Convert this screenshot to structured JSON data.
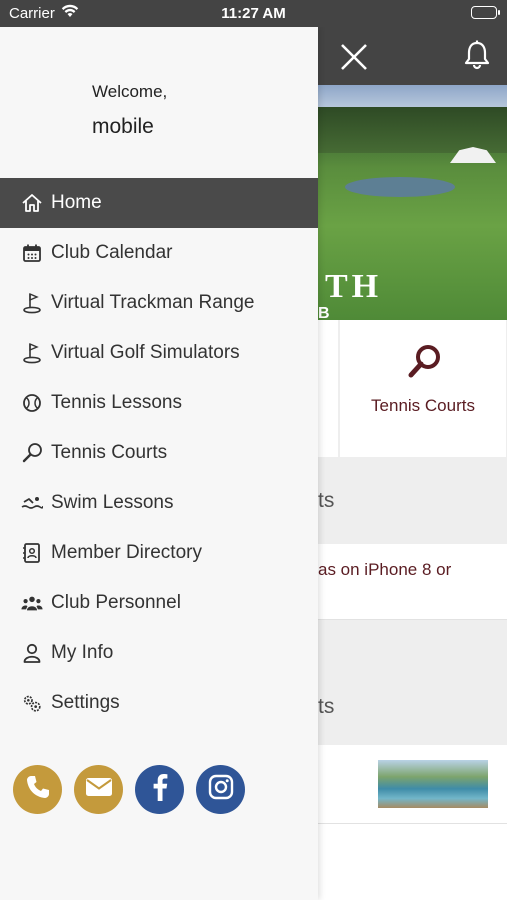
{
  "status_bar": {
    "carrier": "Carrier",
    "time": "11:27 AM"
  },
  "drawer": {
    "welcome": "Welcome,",
    "username": "mobile",
    "menu": [
      {
        "label": "Home",
        "icon": "home-icon",
        "active": true
      },
      {
        "label": "Club Calendar",
        "icon": "calendar-icon"
      },
      {
        "label": "Virtual Trackman Range",
        "icon": "golf-flag-icon"
      },
      {
        "label": "Virtual Golf Simulators",
        "icon": "golf-flag-icon"
      },
      {
        "label": "Tennis Lessons",
        "icon": "tennis-ball-icon"
      },
      {
        "label": "Tennis Courts",
        "icon": "tennis-racket-icon"
      },
      {
        "label": "Swim Lessons",
        "icon": "swimmer-icon"
      },
      {
        "label": "Member Directory",
        "icon": "contact-book-icon"
      },
      {
        "label": "Club Personnel",
        "icon": "people-group-icon"
      },
      {
        "label": "My Info",
        "icon": "user-icon"
      },
      {
        "label": "Settings",
        "icon": "gears-icon"
      }
    ],
    "socials": [
      {
        "name": "phone",
        "icon": "phone-icon",
        "color": "#c49a3c"
      },
      {
        "name": "email",
        "icon": "envelope-icon",
        "color": "#c49a3c"
      },
      {
        "name": "facebook",
        "icon": "facebook-icon",
        "color": "#2f5597"
      },
      {
        "name": "instagram",
        "icon": "instagram-icon",
        "color": "#2f5597"
      }
    ]
  },
  "background": {
    "header_icons": [
      "close-icon",
      "bell-icon"
    ],
    "hero_text": "TH",
    "hero_subtext": "B",
    "tile_label": "Tennis Courts",
    "section1_title": "ts",
    "row1_text": "as on iPhone 8 or",
    "section2_title": "ts"
  },
  "colors": {
    "header": "#444444",
    "active_menu": "#4a4a4a",
    "accent_maroon": "#5a1c22",
    "gold": "#c49a3c",
    "blue": "#2f5597"
  }
}
